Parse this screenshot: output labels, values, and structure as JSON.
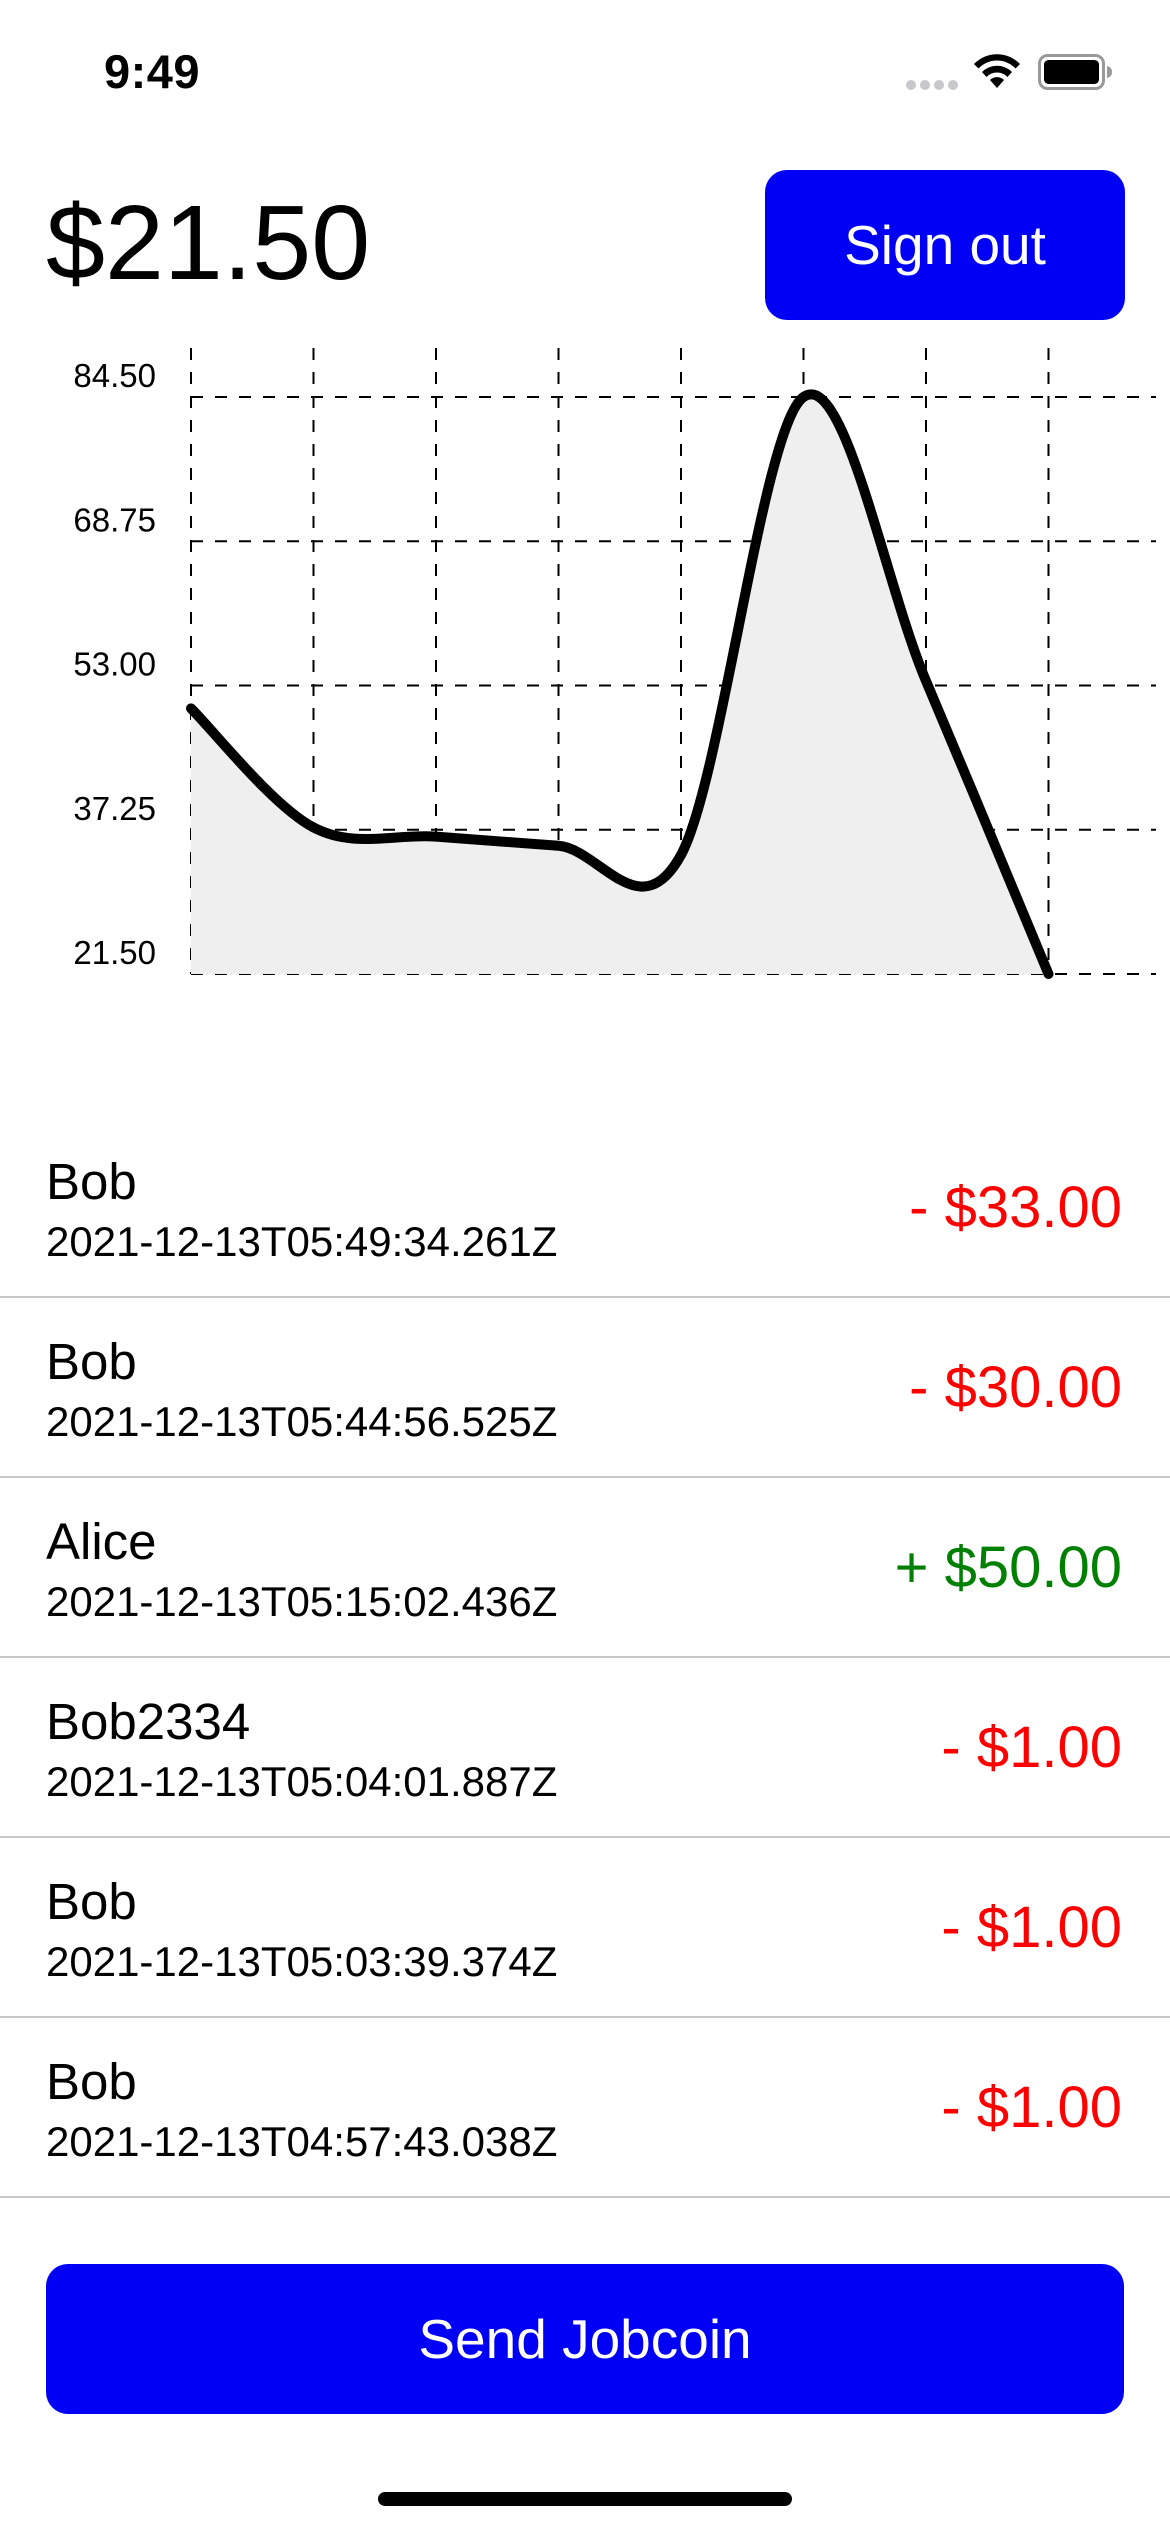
{
  "status_bar": {
    "time": "9:49",
    "wifi_icon": "wifi-icon",
    "battery_icon": "battery-icon"
  },
  "header": {
    "balance": "$21.50",
    "signout_label": "Sign out"
  },
  "chart_data": {
    "type": "area",
    "y_tick_labels": [
      "84.50",
      "68.75",
      "53.00",
      "37.25",
      "21.50"
    ],
    "ylim": [
      21.5,
      84.5
    ],
    "x": [
      0,
      1,
      2,
      3,
      4,
      5,
      6,
      7
    ],
    "values": [
      50.5,
      37.5,
      36.5,
      35.5,
      34.5,
      84.5,
      53.5,
      21.5
    ],
    "grid": true,
    "line_color": "#000000",
    "fill_color": "#efefef"
  },
  "transactions": [
    {
      "name": "Bob",
      "timestamp": "2021-12-13T05:49:34.261Z",
      "amount": "- $33.00",
      "direction": "out"
    },
    {
      "name": "Bob",
      "timestamp": "2021-12-13T05:44:56.525Z",
      "amount": "- $30.00",
      "direction": "out"
    },
    {
      "name": "Alice",
      "timestamp": "2021-12-13T05:15:02.436Z",
      "amount": "+ $50.00",
      "direction": "in"
    },
    {
      "name": "Bob2334",
      "timestamp": "2021-12-13T05:04:01.887Z",
      "amount": "- $1.00",
      "direction": "out"
    },
    {
      "name": "Bob",
      "timestamp": "2021-12-13T05:03:39.374Z",
      "amount": "- $1.00",
      "direction": "out"
    },
    {
      "name": "Bob",
      "timestamp": "2021-12-13T04:57:43.038Z",
      "amount": "- $1.00",
      "direction": "out"
    }
  ],
  "send_label": "Send Jobcoin",
  "colors": {
    "accent": "#0000f5",
    "negative": "#ff0000",
    "positive": "#008000",
    "divider": "#c6c6c8"
  }
}
